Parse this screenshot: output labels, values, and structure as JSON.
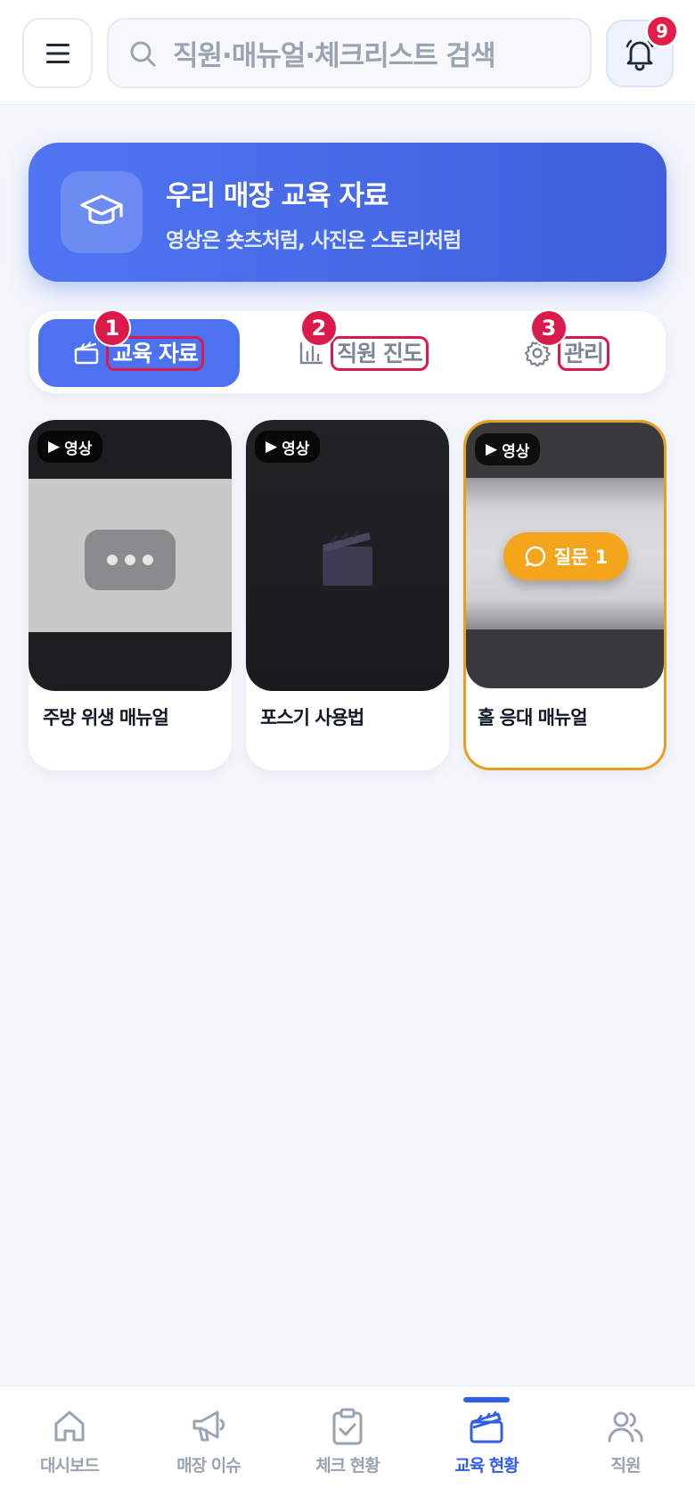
{
  "header": {
    "search_placeholder": "직원·매뉴얼·체크리스트 검색",
    "notification_count": "9"
  },
  "banner": {
    "title": "우리 매장 교육 자료",
    "subtitle": "영상은 숏츠처럼, 사진은 스토리처럼"
  },
  "tabs": [
    {
      "label": "교육 자료",
      "badge": "1",
      "active": true
    },
    {
      "label": "직원 진도",
      "badge": "2",
      "active": false
    },
    {
      "label": "관리",
      "badge": "3",
      "active": false
    }
  ],
  "cards": [
    {
      "type_label": "영상",
      "title": "주방 위생 매뉴얼"
    },
    {
      "type_label": "영상",
      "title": "포스기 사용법"
    },
    {
      "type_label": "영상",
      "title": "홀 응대 매뉴얼",
      "question_label": "질문 1"
    }
  ],
  "bottom_nav": [
    {
      "label": "대시보드",
      "icon": "home-icon"
    },
    {
      "label": "매장 이슈",
      "icon": "megaphone-icon"
    },
    {
      "label": "체크 현황",
      "icon": "clipboard-check-icon"
    },
    {
      "label": "교육 현황",
      "icon": "clapperboard-icon",
      "active": true
    },
    {
      "label": "직원",
      "icon": "users-icon"
    }
  ],
  "colors": {
    "primary": "#4c72f0",
    "badge": "#d91a4a",
    "question": "#f4a51c"
  }
}
